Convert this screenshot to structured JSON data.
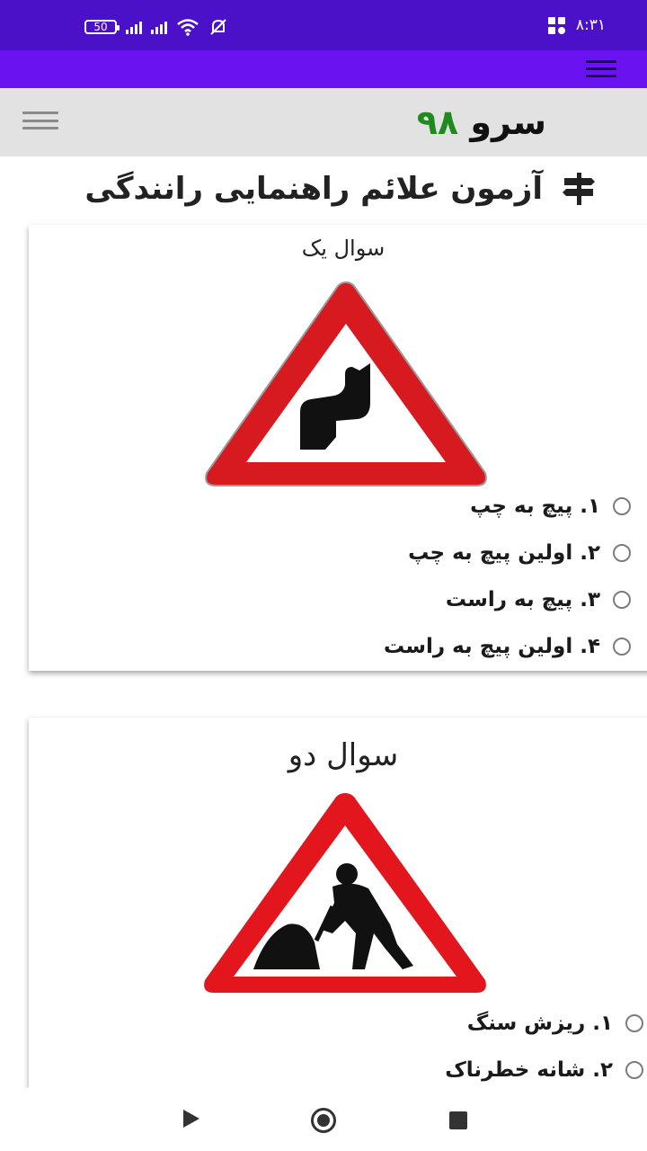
{
  "status_bar": {
    "battery": "50",
    "time": "۸:۳۱"
  },
  "header": {
    "brand_part1": "سرو",
    "brand_part2": "۹۸"
  },
  "page": {
    "title": "آزمون علائم راهنمایی رانندگی",
    "title_icon": "signpost-icon"
  },
  "questions": [
    {
      "title": "سوال یک",
      "sign": "double-bend-warning-sign",
      "options": [
        "۱. پیچ به چپ",
        "۲. اولین پیچ به چپ",
        "۳. پیچ به راست",
        "۴. اولین پیچ به راست"
      ]
    },
    {
      "title": "سوال دو",
      "sign": "road-works-warning-sign",
      "options": [
        "۱. ریزش سنگ",
        "۲. شانه خطرناک"
      ]
    }
  ],
  "colors": {
    "status_bar": "#4a11c9",
    "app_bar": "#6a12f0",
    "header": "#e2e2e2",
    "brand_accent": "#1f8b1f",
    "sign_red": "#d71920"
  }
}
